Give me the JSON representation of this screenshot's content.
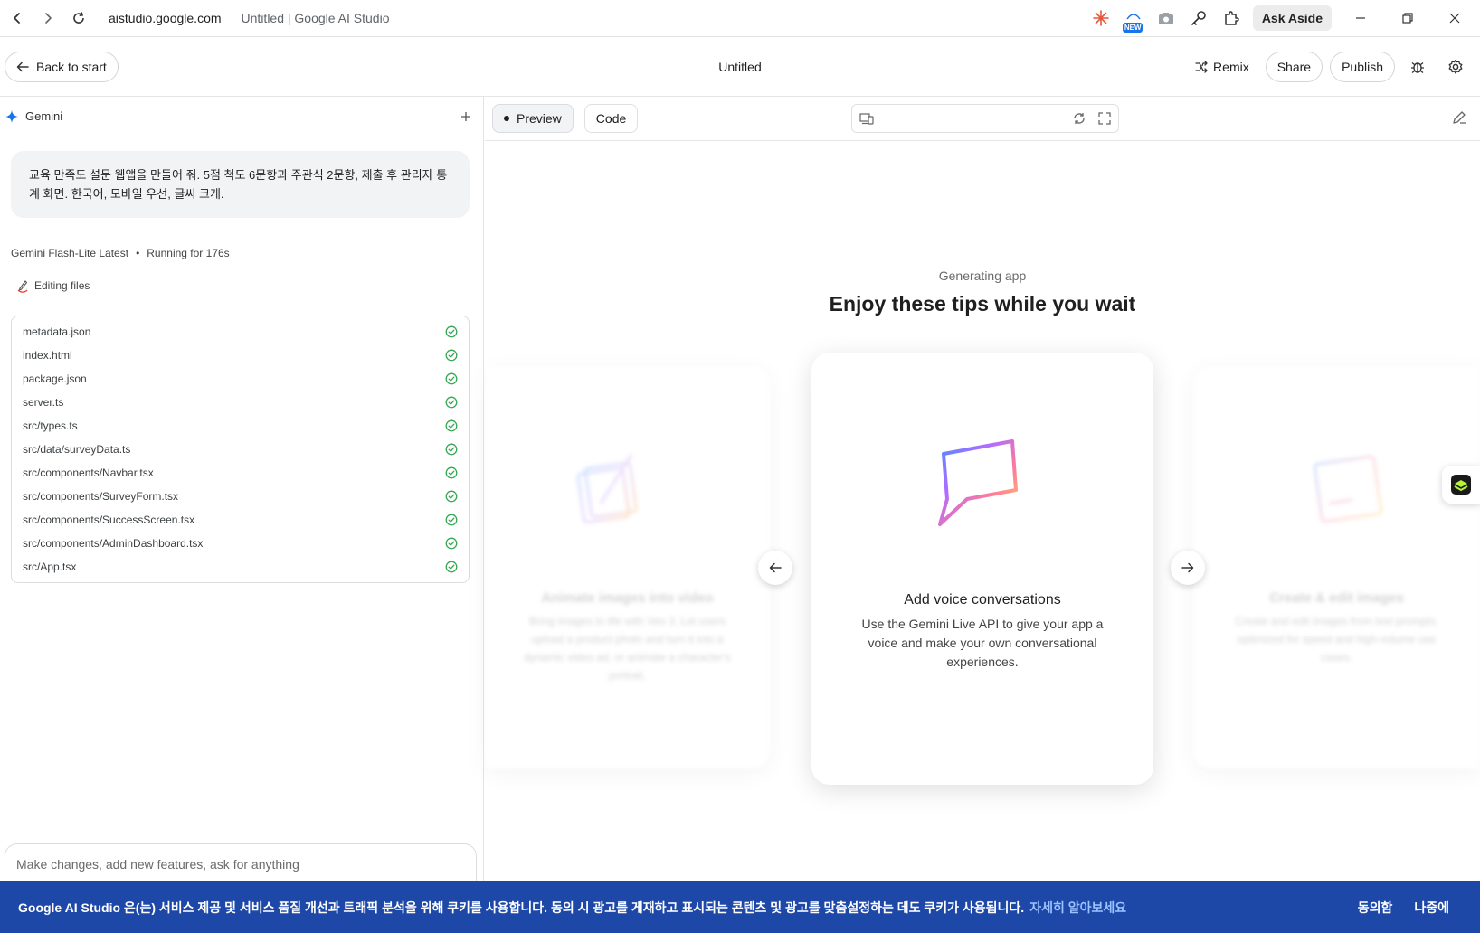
{
  "browser": {
    "url": "aistudio.google.com",
    "tab_title": "Untitled | Google AI Studio",
    "new_badge": "NEW",
    "ask_aside": "Ask Aside"
  },
  "header": {
    "back_label": "Back to start",
    "title": "Untitled",
    "remix_label": "Remix",
    "share_label": "Share",
    "publish_label": "Publish"
  },
  "left": {
    "model_name": "Gemini",
    "prompt": "교육 만족도 설문 웹앱을 만들어 줘. 5점 척도 6문항과 주관식 2문항, 제출 후 관리자 통계 화면. 한국어, 모바일 우선, 글씨 크게.",
    "model_label": "Gemini Flash-Lite Latest",
    "status": "Running for 176s",
    "editing_label": "Editing files",
    "files": [
      "metadata.json",
      "index.html",
      "package.json",
      "server.ts",
      "src/types.ts",
      "src/data/surveyData.ts",
      "src/components/Navbar.tsx",
      "src/components/SurveyForm.tsx",
      "src/components/SuccessScreen.tsx",
      "src/components/AdminDashboard.tsx",
      "src/App.tsx"
    ],
    "input_placeholder": "Make changes, add new features, ask for anything"
  },
  "right": {
    "tab_preview": "Preview",
    "tab_code": "Code",
    "generating_label": "Generating app",
    "tips_title": "Enjoy these tips while you wait",
    "cards": {
      "left": {
        "title": "Animate images into video",
        "desc": "Bring images to life with Veo 3. Let users upload a product photo and turn it into a dynamic video ad, or animate a character's portrait."
      },
      "center": {
        "title": "Add voice conversations",
        "desc": "Use the Gemini Live API to give your app a voice and make your own conversational experiences."
      },
      "right": {
        "title": "Create & edit images",
        "desc": "Create and edit images from text prompts, optimized for speed and high-volume use cases."
      }
    }
  },
  "cookie": {
    "text": "Google AI Studio 은(는) 서비스 제공 및 서비스 품질 개선과 트래픽 분석을 위해 쿠키를 사용합니다. 동의 시 광고를 게재하고 표시되는 콘텐츠 및 광고를 맞춤설정하는 데도 쿠키가 사용됩니다.",
    "link": "자세히 알아보세요",
    "agree": "동의함",
    "later": "나중에"
  },
  "colors": {
    "cookie_bg": "#1d48a8",
    "check_green": "#34a853",
    "gemini_blue": "#1a73e8"
  }
}
